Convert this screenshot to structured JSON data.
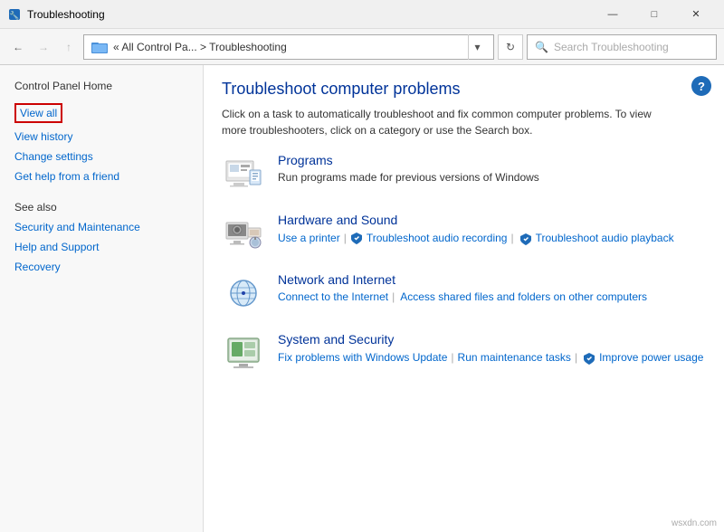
{
  "titlebar": {
    "icon": "🛠",
    "title": "Troubleshooting",
    "minimize": "—",
    "maximize": "□",
    "close": "✕"
  },
  "addressbar": {
    "back_label": "←",
    "forward_label": "→",
    "up_label": "↑",
    "path_icon": "🖼",
    "path_text": "« All Control Pa...  >  Troubleshooting",
    "dropdown": "▾",
    "refresh": "↻",
    "search_placeholder": "Search Troubleshooting"
  },
  "sidebar": {
    "home_label": "Control Panel Home",
    "links": [
      {
        "id": "view-all",
        "label": "View all",
        "highlighted": true
      },
      {
        "id": "view-history",
        "label": "View history",
        "highlighted": false
      },
      {
        "id": "change-settings",
        "label": "Change settings",
        "highlighted": false
      },
      {
        "id": "get-help",
        "label": "Get help from a friend",
        "highlighted": false
      }
    ],
    "see_also_label": "See also",
    "see_also_links": [
      {
        "id": "security",
        "label": "Security and Maintenance"
      },
      {
        "id": "help-support",
        "label": "Help and Support"
      },
      {
        "id": "recovery",
        "label": "Recovery"
      }
    ]
  },
  "content": {
    "title": "Troubleshoot computer problems",
    "description": "Click on a task to automatically troubleshoot and fix common computer problems. To view more troubleshooters, click on a category or use the Search box.",
    "help_icon": "?",
    "categories": [
      {
        "id": "programs",
        "name": "Programs",
        "subtitle": "Run programs made for previous versions of Windows",
        "links": []
      },
      {
        "id": "hardware-sound",
        "name": "Hardware and Sound",
        "subtitle": "",
        "links": [
          {
            "id": "printer",
            "label": "Use a printer",
            "shield": false
          },
          {
            "id": "audio-recording",
            "label": "Troubleshoot audio recording",
            "shield": true
          },
          {
            "id": "audio-playback",
            "label": "Troubleshoot audio playback",
            "shield": true
          }
        ]
      },
      {
        "id": "network-internet",
        "name": "Network and Internet",
        "subtitle": "",
        "links": [
          {
            "id": "connect-internet",
            "label": "Connect to the Internet",
            "shield": false
          },
          {
            "id": "shared-files",
            "label": "Access shared files and folders on other computers",
            "shield": false
          }
        ]
      },
      {
        "id": "system-security",
        "name": "System and Security",
        "subtitle": "",
        "links": [
          {
            "id": "windows-update",
            "label": "Fix problems with Windows Update",
            "shield": false
          },
          {
            "id": "maintenance",
            "label": "Run maintenance tasks",
            "shield": false
          },
          {
            "id": "power-usage",
            "label": "Improve power usage",
            "shield": true
          }
        ]
      }
    ]
  },
  "watermark": "wsxdn.com"
}
